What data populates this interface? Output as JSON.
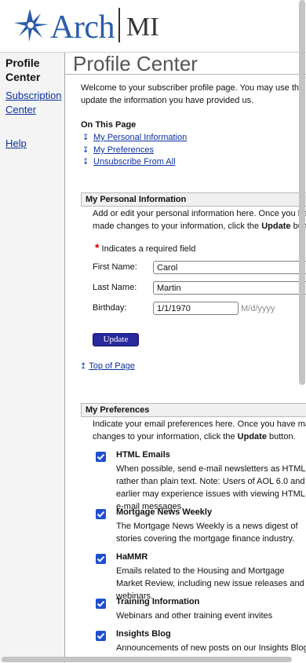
{
  "header": {
    "logo_text": "Arch",
    "logo_suffix": "MI",
    "brand_color": "#2b5ca8"
  },
  "sidebar": {
    "title": "Profile Center",
    "items": [
      {
        "label": "Subscription Center",
        "icon": ""
      },
      {
        "label": "Help",
        "icon": ""
      }
    ]
  },
  "main": {
    "title": "Profile Center",
    "intro": "Welcome to your subscriber profile page. You may use this page to change or update the information you have provided us.",
    "on_this_page": {
      "heading": "On This Page",
      "links": [
        "My Personal Information",
        "My Preferences",
        "Unsubscribe From All"
      ]
    },
    "personal": {
      "heading": "My Personal Information",
      "description_before": "Add or edit your personal information here. Once you have made changes to your information, click the ",
      "description_bold": "Update",
      "description_after": " button.",
      "required_note": "Indicates a required field",
      "fields": {
        "first_name": {
          "label": "First Name:",
          "value": "Carol"
        },
        "last_name": {
          "label": "Last Name:",
          "value": "Martin"
        },
        "birthday": {
          "label": "Birthday:",
          "value": "1/1/1970",
          "hint": "M/d/yyyy"
        }
      },
      "update_label": "Update",
      "top_link": "Top of Page"
    },
    "preferences": {
      "heading": "My Preferences",
      "description_before": "Indicate your email preferences here. Once you have made changes to your information, click the ",
      "description_bold": "Update",
      "description_after": " button.",
      "items": [
        {
          "title": "HTML Emails",
          "desc": "When possible, send e-mail newsletters as HTML rather than plain text. Note: Users of AOL 6.0 and earlier may experience issues with viewing HTML e-mail messages.",
          "checked": true
        },
        {
          "title": "Mortgage News Weekly",
          "desc": "The Mortgage News Weekly is a news digest of stories covering the mortgage finance industry.",
          "checked": true
        },
        {
          "title": "HaMMR",
          "desc": "Emails related to the Housing and Mortgage Market Review, including new issue releases and webinars.",
          "checked": true
        },
        {
          "title": "Training Information",
          "desc": "Webinars and other training event invites",
          "checked": true
        },
        {
          "title": "Insights Blog",
          "desc": "Announcements of new posts on our Insights Blog",
          "checked": true
        }
      ]
    }
  },
  "colors": {
    "link": "#0b31a0",
    "checkbox": "#1f4fd0",
    "button": "#2a2a9e",
    "required": "#cc0000"
  }
}
